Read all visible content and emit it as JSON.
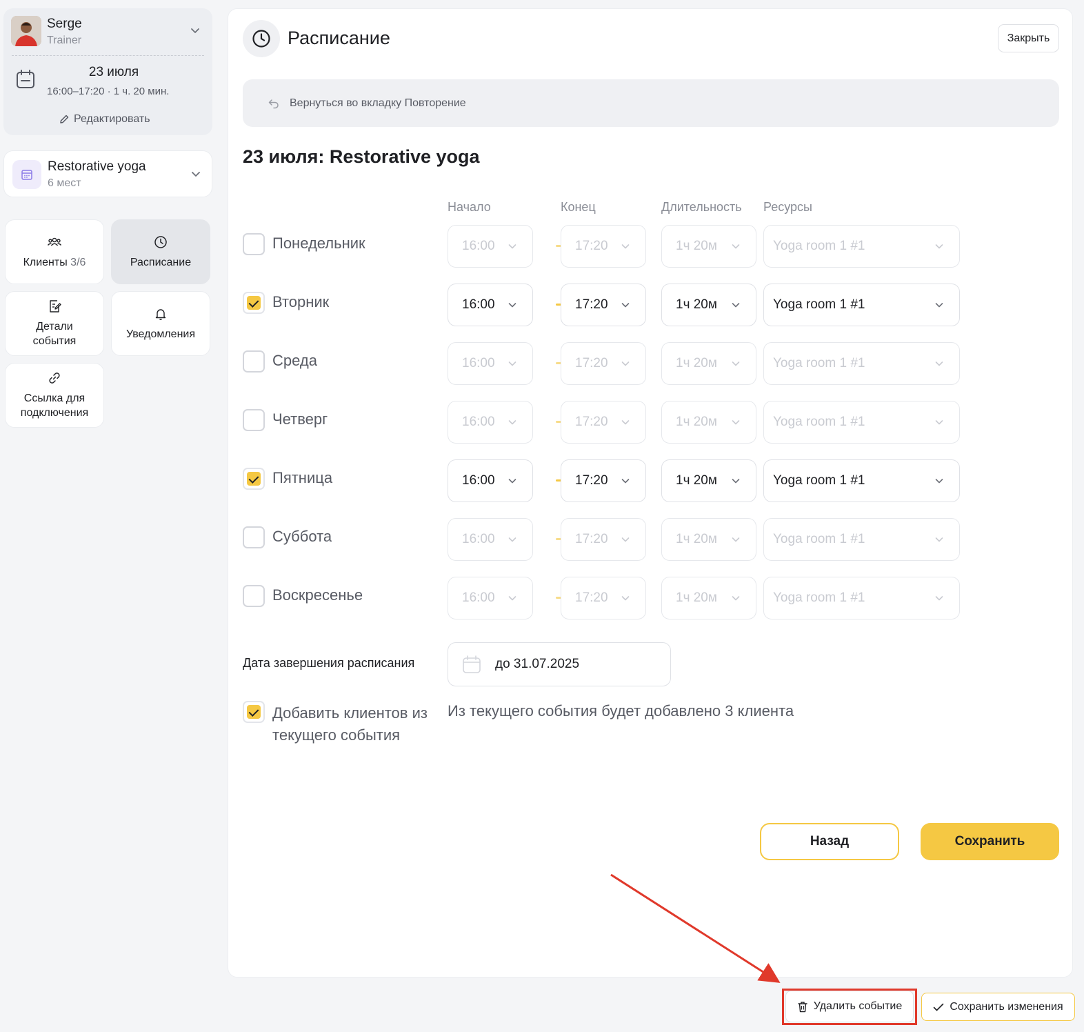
{
  "trainer": {
    "name": "Serge",
    "role": "Trainer",
    "date": "23 июля",
    "time": "16:00–17:20 · 1 ч. 20 мин.",
    "edit_label": "Редактировать"
  },
  "event": {
    "name": "Restorative yoga",
    "seats": "6 мест"
  },
  "nav": {
    "clients_label": "Клиенты",
    "clients_count": "3/6",
    "schedule_label": "Расписание",
    "details_label_1": "Детали",
    "details_label_2": "события",
    "notifications_label": "Уведомления",
    "link_label_1": "Ссылка для",
    "link_label_2": "подключения"
  },
  "header": {
    "title": "Расписание",
    "close_label": "Закрыть"
  },
  "back_banner": "Вернуться во вкладку Повторение",
  "section_title": "23 июля: Restorative yoga",
  "columns": {
    "start": "Начало",
    "end": "Конец",
    "duration": "Длительность",
    "resources": "Ресурсы"
  },
  "days": [
    {
      "label": "Понедельник",
      "checked": false,
      "start": "16:00",
      "end": "17:20",
      "duration": "1ч 20м",
      "resource": "Yoga room 1 #1"
    },
    {
      "label": "Вторник",
      "checked": true,
      "start": "16:00",
      "end": "17:20",
      "duration": "1ч 20м",
      "resource": "Yoga room 1 #1"
    },
    {
      "label": "Среда",
      "checked": false,
      "start": "16:00",
      "end": "17:20",
      "duration": "1ч 20м",
      "resource": "Yoga room 1 #1"
    },
    {
      "label": "Четверг",
      "checked": false,
      "start": "16:00",
      "end": "17:20",
      "duration": "1ч 20м",
      "resource": "Yoga room 1 #1"
    },
    {
      "label": "Пятница",
      "checked": true,
      "start": "16:00",
      "end": "17:20",
      "duration": "1ч 20м",
      "resource": "Yoga room 1 #1"
    },
    {
      "label": "Суббота",
      "checked": false,
      "start": "16:00",
      "end": "17:20",
      "duration": "1ч 20м",
      "resource": "Yoga room 1 #1"
    },
    {
      "label": "Воскресенье",
      "checked": false,
      "start": "16:00",
      "end": "17:20",
      "duration": "1ч 20м",
      "resource": "Yoga room 1 #1"
    }
  ],
  "end_date": {
    "label": "Дата завершения расписания",
    "value": "до 31.07.2025"
  },
  "add_clients": {
    "checked": true,
    "label_1": "Добавить клиентов из",
    "label_2": "текущего события",
    "note": "Из текущего события будет добавлено 3 клиента"
  },
  "actions": {
    "back_label": "Назад",
    "save_label": "Сохранить"
  },
  "footer": {
    "delete_label": "Удалить событие",
    "save_changes_label": "Сохранить изменения"
  },
  "colors": {
    "accent": "#f5c843",
    "annotation": "#e0392b"
  }
}
